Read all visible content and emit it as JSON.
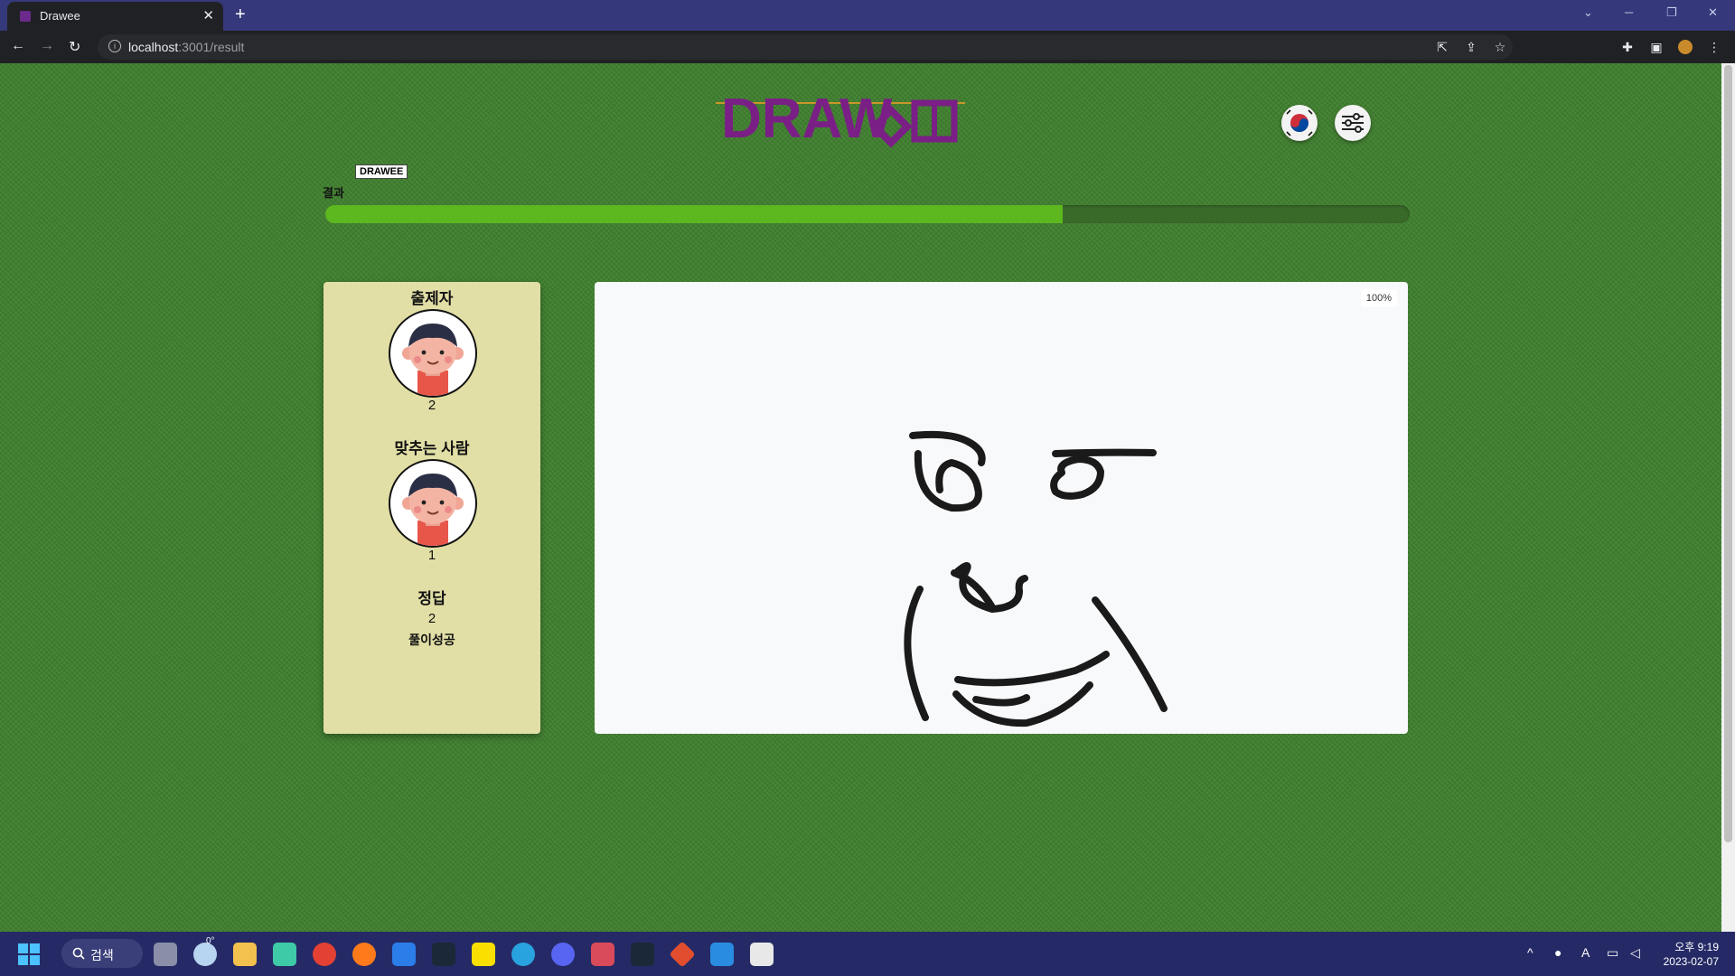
{
  "browser": {
    "tab_title": "Drawee",
    "url_host": "localhost",
    "url_path": ":3001/result"
  },
  "header": {
    "logo_text": "DRAWEE",
    "tooltip": "DRAWEE"
  },
  "progress": {
    "label": "결과",
    "value_percent": 68,
    "color": "#5cb81e"
  },
  "result_panel": {
    "questioner_title": "출제자",
    "questioner_value": "2",
    "guesser_title": "맞추는 사람",
    "guesser_value": "1",
    "answer_title": "정답",
    "answer_value": "2",
    "answer_status": "풀이성공",
    "background": "#e2dfa6"
  },
  "canvas": {
    "zoom": "100%"
  },
  "taskbar": {
    "search_label": "검색",
    "weather_temp": "0°",
    "time": "오후 9:19",
    "date": "2023-02-07"
  }
}
